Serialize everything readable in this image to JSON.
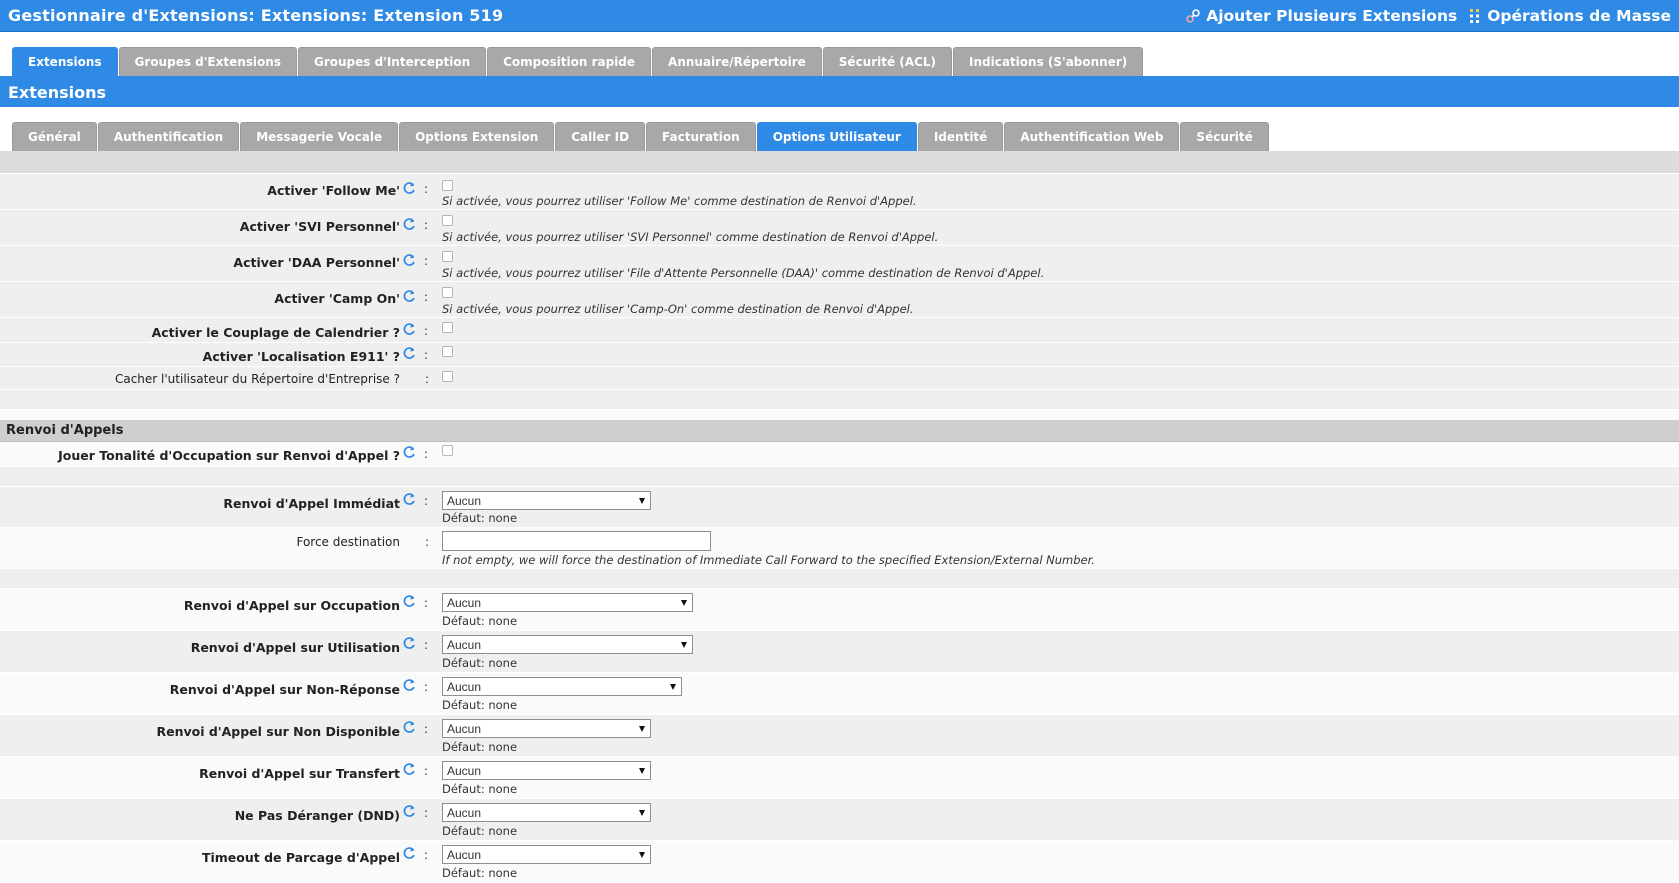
{
  "header": {
    "title": "Gestionnaire d'Extensions:  Extensions:  Extension 519",
    "add_multiple": "Ajouter Plusieurs Extensions",
    "bulk_ops": "Opérations de Masse"
  },
  "main_tabs": [
    {
      "label": "Extensions",
      "active": true
    },
    {
      "label": "Groupes d'Extensions",
      "active": false
    },
    {
      "label": "Groupes d'Interception",
      "active": false
    },
    {
      "label": "Composition rapide",
      "active": false
    },
    {
      "label": "Annuaire/Répertoire",
      "active": false
    },
    {
      "label": "Sécurité (ACL)",
      "active": false
    },
    {
      "label": "Indications (S'abonner)",
      "active": false
    }
  ],
  "section_title": "Extensions",
  "sub_tabs": [
    {
      "label": "Général",
      "active": false
    },
    {
      "label": "Authentification",
      "active": false
    },
    {
      "label": "Messagerie Vocale",
      "active": false
    },
    {
      "label": "Options Extension",
      "active": false
    },
    {
      "label": "Caller ID",
      "active": false
    },
    {
      "label": "Facturation",
      "active": false
    },
    {
      "label": "Options Utilisateur",
      "active": true
    },
    {
      "label": "Identité",
      "active": false
    },
    {
      "label": "Authentification Web",
      "active": false
    },
    {
      "label": "Sécurité",
      "active": false
    }
  ],
  "options": [
    {
      "label": "Activer 'Follow Me'",
      "hint": "Si activée, vous pourrez utiliser 'Follow Me' comme destination de Renvoi d'Appel."
    },
    {
      "label": "Activer 'SVI Personnel'",
      "hint": "Si activée, vous pourrez utiliser 'SVI Personnel' comme destination de Renvoi d'Appel."
    },
    {
      "label": "Activer 'DAA Personnel'",
      "hint": "Si activée, vous pourrez utiliser 'File d'Attente Personnelle (DAA)' comme destination de Renvoi d'Appel."
    },
    {
      "label": "Activer 'Camp On'",
      "hint": "Si activée, vous pourrez utiliser 'Camp-On' comme destination de Renvoi d'Appel."
    },
    {
      "label": "Activer le Couplage de Calendrier ?"
    },
    {
      "label": "Activer 'Localisation E911' ?"
    },
    {
      "label": "Cacher l'utilisateur du Répertoire d'Entreprise ?"
    }
  ],
  "forwarding": {
    "group_title": "Renvoi d'Appels",
    "busy_tone_label": "Jouer Tonalité d'Occupation sur Renvoi d'Appel ?",
    "immediate": {
      "label": "Renvoi d'Appel Immédiat",
      "value": "Aucun",
      "default": "Défaut: none"
    },
    "force_dest": {
      "label": "Force destination",
      "value": "",
      "hint": "If not empty, we will force the destination of Immediate Call Forward to the specified Extension/External Number."
    },
    "selects": [
      {
        "label": "Renvoi d'Appel sur Occupation",
        "value": "Aucun",
        "default": "Défaut: none"
      },
      {
        "label": "Renvoi d'Appel sur Utilisation",
        "value": "Aucun",
        "default": "Défaut: none"
      },
      {
        "label": "Renvoi d'Appel sur Non-Réponse",
        "value": "Aucun",
        "default": "Défaut: none"
      },
      {
        "label": "Renvoi d'Appel sur Non Disponible",
        "value": "Aucun",
        "default": "Défaut: none"
      },
      {
        "label": "Renvoi d'Appel sur Transfert",
        "value": "Aucun",
        "default": "Défaut: none"
      },
      {
        "label": "Ne Pas Déranger (DND)",
        "value": "Aucun",
        "default": "Défaut: none"
      },
      {
        "label": "Timeout de Parcage d'Appel",
        "value": "Aucun",
        "default": "Défaut: none"
      }
    ]
  },
  "colon": ":",
  "colors": {
    "accent": "#2f8ae5",
    "tab_inactive": "#a8a8a8"
  },
  "icons": {
    "refresh": "refresh-icon",
    "add_multiple": "add-multiple-icon",
    "bulk": "bulk-ops-icon",
    "dropdown": "chevron-down-icon"
  }
}
